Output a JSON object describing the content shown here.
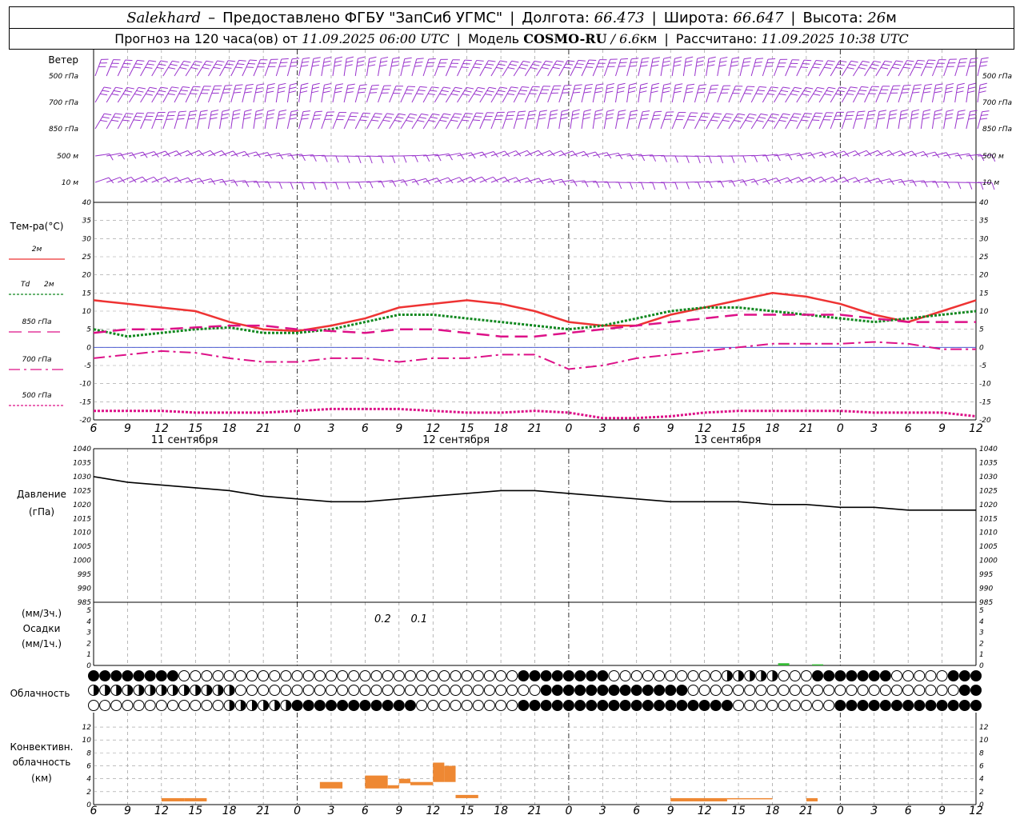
{
  "header": {
    "station": "Salekhard",
    "dash": "–",
    "provider": "Предоставлено ФГБУ \"ЗапСиб УГМС\"",
    "lon_label": "Долгота:",
    "lon": "66.473",
    "lat_label": "Широта:",
    "lat": "66.647",
    "alt_label": "Высота:",
    "alt": "26",
    "alt_unit": "м",
    "forecast_prefix": "Прогноз на 120 часа(ов) от",
    "forecast_time": "11.09.2025 06:00 UTC",
    "model_label": "Модель",
    "model": "COSMO-RU",
    "slash": "/",
    "model_res": "6.6",
    "model_res_unit": "км",
    "computed_label": "Рассчитано:",
    "computed_time": "11.09.2025 10:38 UTC"
  },
  "time_axis": {
    "hours": [
      "6",
      "9",
      "12",
      "15",
      "18",
      "21",
      "0",
      "3",
      "6",
      "9",
      "12",
      "15",
      "18",
      "21",
      "0",
      "3",
      "6",
      "9",
      "12",
      "15",
      "18",
      "21",
      "0",
      "3",
      "6",
      "9",
      "12"
    ],
    "days": [
      "11 сентября",
      "12 сентября",
      "13 сентября"
    ]
  },
  "wind": {
    "title": "Ветер",
    "levels": [
      "500 гПа",
      "700 гПа",
      "850 гПа",
      "500 м",
      "10 м"
    ],
    "color": "#9933cc"
  },
  "temperature": {
    "title": "Тем-ра(°C)",
    "ticks": [
      "40",
      "35",
      "30",
      "25",
      "20",
      "15",
      "10",
      "5",
      "0",
      "-5",
      "-10",
      "-15",
      "-20"
    ],
    "legend": [
      {
        "label": "2м",
        "color": "#ee3333",
        "style": "solid"
      },
      {
        "label": "Td",
        "label2": "2м",
        "color": "#11881f",
        "style": "dotted"
      },
      {
        "label": "850 гПа",
        "color": "#dd1188",
        "style": "dash"
      },
      {
        "label": "700 гПа",
        "color": "#dd1188",
        "style": "dashdot"
      },
      {
        "label": "500 гПа",
        "color": "#dd1188",
        "style": "dot"
      }
    ]
  },
  "pressure": {
    "title1": "Давление",
    "title2": "(гПа)",
    "ticks": [
      "1040",
      "1035",
      "1030",
      "1025",
      "1020",
      "1015",
      "1010",
      "1005",
      "1000",
      "995",
      "990",
      "985"
    ]
  },
  "precip": {
    "title1": "(мм/3ч.)",
    "title2": "Осадки",
    "title3": "(мм/1ч.)",
    "ticks": [
      "5",
      "4",
      "3",
      "2",
      "1",
      "0"
    ],
    "cumulative": [
      "0.2",
      "0.1"
    ],
    "color": "#33bb33"
  },
  "clouds": {
    "title": "Облачность"
  },
  "convective": {
    "title1": "Конвективн.",
    "title2": "облачность",
    "title3": "(км)",
    "ticks": [
      "12",
      "10",
      "8",
      "6",
      "4",
      "2",
      "0"
    ],
    "color": "#ee8833"
  },
  "chart_data": [
    {
      "type": "line",
      "title": "Тем-ра(°C)",
      "x": [
        0,
        3,
        6,
        9,
        12,
        15,
        18,
        21,
        24,
        27,
        30,
        33,
        36,
        39,
        42,
        45,
        48,
        51,
        54,
        57,
        60,
        63,
        66,
        69,
        72,
        75,
        78
      ],
      "ylim": [
        -20,
        40
      ],
      "series": [
        {
          "name": "2м",
          "values": [
            13,
            12,
            11,
            10,
            7,
            5,
            4.5,
            6,
            8,
            11,
            12,
            13,
            12,
            10,
            7,
            6,
            6,
            9,
            11,
            13,
            15,
            14,
            12,
            9,
            7,
            10,
            13
          ]
        },
        {
          "name": "Td 2м",
          "values": [
            5,
            3,
            4,
            5,
            5.5,
            4,
            4,
            5,
            7,
            9,
            9,
            8,
            7,
            6,
            5,
            6,
            8,
            10,
            11,
            11,
            10,
            9,
            8,
            7,
            8,
            9,
            10
          ]
        },
        {
          "name": "850 гПа",
          "values": [
            4,
            5,
            5,
            5.5,
            6,
            6,
            5,
            4.5,
            4,
            5,
            5,
            4,
            3,
            3,
            4,
            5,
            6,
            7,
            8,
            9,
            9,
            9,
            9,
            8,
            7,
            7,
            7
          ]
        },
        {
          "name": "700 гПа",
          "values": [
            -3,
            -2,
            -1,
            -1.5,
            -3,
            -4,
            -4,
            -3,
            -3,
            -4,
            -3,
            -3,
            -2,
            -2,
            -6,
            -5,
            -3,
            -2,
            -1,
            0,
            1,
            1,
            1,
            1.5,
            1,
            -0.5,
            -0.5
          ]
        },
        {
          "name": "500 гПа",
          "values": [
            -17.5,
            -17.5,
            -17.5,
            -18,
            -18,
            -18,
            -17.5,
            -17,
            -17,
            -17,
            -17.5,
            -18,
            -18,
            -17.5,
            -18,
            -19.5,
            -19.5,
            -19,
            -18,
            -17.5,
            -17.5,
            -17.5,
            -17.5,
            -18,
            -18,
            -18,
            -19
          ]
        }
      ]
    },
    {
      "type": "line",
      "title": "Давление (гПа)",
      "x": [
        0,
        3,
        6,
        9,
        12,
        15,
        18,
        21,
        24,
        27,
        30,
        33,
        36,
        39,
        42,
        45,
        48,
        51,
        54,
        57,
        60,
        63,
        66,
        69,
        72,
        75,
        78
      ],
      "ylim": [
        985,
        1040
      ],
      "series": [
        {
          "name": "Давление",
          "values": [
            1030,
            1028,
            1027,
            1026,
            1025,
            1023,
            1022,
            1021,
            1021,
            1022,
            1023,
            1024,
            1025,
            1025,
            1024,
            1023,
            1022,
            1021,
            1021,
            1021,
            1020,
            1020,
            1019,
            1019,
            1018,
            1018,
            1018
          ]
        }
      ]
    },
    {
      "type": "bar",
      "title": "Осадки",
      "x": [
        61,
        64
      ],
      "ylim": [
        0,
        5
      ],
      "values": [
        0.2,
        0.1
      ]
    },
    {
      "type": "bar",
      "title": "Конвективн. облачность (км)",
      "ylim": [
        0,
        13
      ],
      "bars": [
        {
          "x0": 6,
          "x1": 8,
          "bottom": 0.5,
          "top": 1
        },
        {
          "x0": 8,
          "x1": 10,
          "bottom": 0.5,
          "top": 1
        },
        {
          "x0": 20,
          "x1": 22,
          "bottom": 2.5,
          "top": 3.5
        },
        {
          "x0": 24,
          "x1": 26,
          "bottom": 2.5,
          "top": 4.5
        },
        {
          "x0": 26,
          "x1": 27,
          "bottom": 2.5,
          "top": 3
        },
        {
          "x0": 27,
          "x1": 28,
          "bottom": 3.3,
          "top": 4
        },
        {
          "x0": 28,
          "x1": 30,
          "bottom": 3,
          "top": 3.5
        },
        {
          "x0": 30,
          "x1": 31,
          "bottom": 3.5,
          "top": 6.5
        },
        {
          "x0": 31,
          "x1": 32,
          "bottom": 3.5,
          "top": 6
        },
        {
          "x0": 32,
          "x1": 34,
          "bottom": 1,
          "top": 1.5
        },
        {
          "x0": 51,
          "x1": 53,
          "bottom": 0.5,
          "top": 1
        },
        {
          "x0": 53,
          "x1": 56,
          "bottom": 0.5,
          "top": 1
        },
        {
          "x0": 56,
          "x1": 60,
          "bottom": 1,
          "top": 1
        },
        {
          "x0": 63,
          "x1": 64,
          "bottom": 0.5,
          "top": 1
        }
      ]
    }
  ]
}
